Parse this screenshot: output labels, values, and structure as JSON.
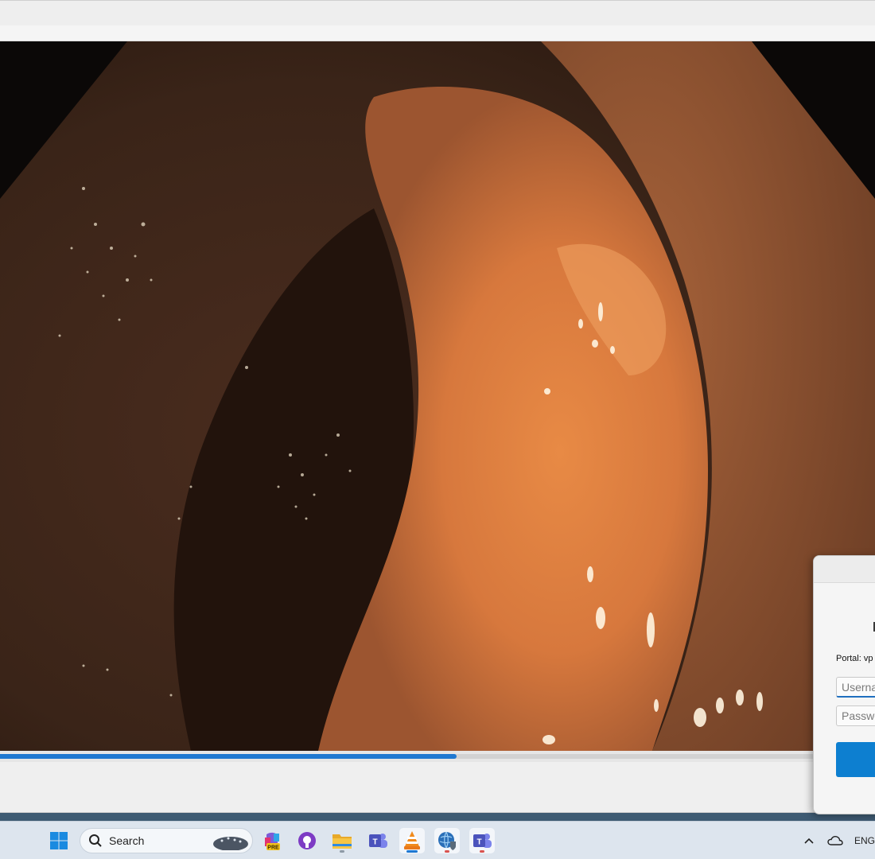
{
  "video": {
    "progress_fraction": 0.522
  },
  "dialog": {
    "portal_label": "Portal: vp",
    "username_placeholder": "Username",
    "password_placeholder": "Password",
    "connect_label": ""
  },
  "taskbar": {
    "search_label": "Search",
    "copilot_badge": "PRE",
    "language": "ENG",
    "icons": [
      "windows-start-icon",
      "search-icon",
      "copilot-icon",
      "github-desktop-icon",
      "file-explorer-icon",
      "teams-icon",
      "vlc-icon",
      "globalprotect-icon",
      "teams-icon",
      "chevron-up-icon",
      "onedrive-cloud-icon"
    ]
  },
  "colors": {
    "accent": "#1f78d1",
    "taskbar_bg": "#dde5ee",
    "connect_button": "#0d7fd0"
  }
}
